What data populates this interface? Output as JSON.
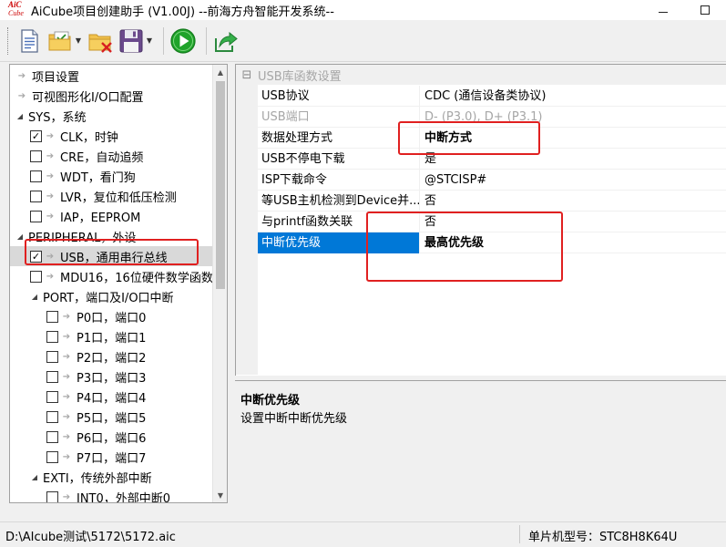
{
  "window": {
    "logo_line1": "AiC",
    "logo_line2": "Cube",
    "title": "AiCube项目创建助手 (V1.00J) --前海方舟智能开发系统--"
  },
  "toolbar": {
    "buttons": [
      {
        "name": "new-project",
        "icon": "document-icon"
      },
      {
        "name": "open-project",
        "icon": "folder-check-icon",
        "has_dropdown": true
      },
      {
        "name": "close-project",
        "icon": "folder-delete-icon"
      },
      {
        "name": "save-project",
        "icon": "floppy-disk-icon",
        "has_dropdown": true
      },
      {
        "name": "run",
        "icon": "play-icon"
      },
      {
        "name": "export",
        "icon": "share-arrow-icon"
      }
    ]
  },
  "tree": {
    "items": [
      {
        "label": "项目设置",
        "level": 0,
        "kind": "leaf"
      },
      {
        "label": "可视图形化I/O口配置",
        "level": 0,
        "kind": "leaf"
      },
      {
        "label": "SYS，系统",
        "level": 0,
        "kind": "expanded"
      },
      {
        "label": "CLK，时钟",
        "level": 1,
        "kind": "check",
        "checked": true
      },
      {
        "label": "CRE，自动追频",
        "level": 1,
        "kind": "check",
        "checked": false
      },
      {
        "label": "WDT，看门狗",
        "level": 1,
        "kind": "check",
        "checked": false
      },
      {
        "label": "LVR，复位和低压检测",
        "level": 1,
        "kind": "check",
        "checked": false
      },
      {
        "label": "IAP，EEPROM",
        "level": 1,
        "kind": "check",
        "checked": false
      },
      {
        "label": "PERIPHERAL，外设",
        "level": 0,
        "kind": "expanded"
      },
      {
        "label": "USB，通用串行总线",
        "level": 1,
        "kind": "check",
        "checked": true,
        "selected": true
      },
      {
        "label": "MDU16，16位硬件数学函数",
        "level": 1,
        "kind": "check",
        "checked": false
      },
      {
        "label": "PORT，端口及I/O口中断",
        "level": 1,
        "kind": "expanded"
      },
      {
        "label": "P0口，端口0",
        "level": 2,
        "kind": "check",
        "checked": false
      },
      {
        "label": "P1口，端口1",
        "level": 2,
        "kind": "check",
        "checked": false
      },
      {
        "label": "P2口，端口2",
        "level": 2,
        "kind": "check",
        "checked": false
      },
      {
        "label": "P3口，端口3",
        "level": 2,
        "kind": "check",
        "checked": false
      },
      {
        "label": "P4口，端口4",
        "level": 2,
        "kind": "check",
        "checked": false
      },
      {
        "label": "P5口，端口5",
        "level": 2,
        "kind": "check",
        "checked": false
      },
      {
        "label": "P6口，端口6",
        "level": 2,
        "kind": "check",
        "checked": false
      },
      {
        "label": "P7口，端口7",
        "level": 2,
        "kind": "check",
        "checked": false
      },
      {
        "label": "EXTI，传统外部中断",
        "level": 1,
        "kind": "expanded"
      },
      {
        "label": "INT0，外部中断0",
        "level": 2,
        "kind": "check",
        "checked": false
      }
    ]
  },
  "properties": {
    "category": "USB库函数设置",
    "rows": [
      {
        "name": "USB协议",
        "value": "CDC (通信设备类协议)"
      },
      {
        "name": "USB端口",
        "value": "D- (P3.0), D+ (P3.1)",
        "disabled": true
      },
      {
        "name": "数据处理方式",
        "value": "中断方式",
        "bold": true
      },
      {
        "name": "USB不停电下载",
        "value": "是"
      },
      {
        "name": "ISP下载命令",
        "value": "@STCISP#"
      },
      {
        "name": "等USB主机检测到Device并...",
        "value": "否"
      },
      {
        "name": "与printf函数关联",
        "value": "否"
      },
      {
        "name": "中断优先级",
        "value": "最高优先级",
        "bold": true,
        "selected": true
      }
    ]
  },
  "description": {
    "title": "中断优先级",
    "text": "设置中断中断优先级"
  },
  "status": {
    "path": "D:\\AIcube测试\\5172\\5172.aic",
    "chip": "单片机型号：STC8H8K64U"
  },
  "colors": {
    "highlight": "#e02020",
    "selection": "#0078d7"
  }
}
